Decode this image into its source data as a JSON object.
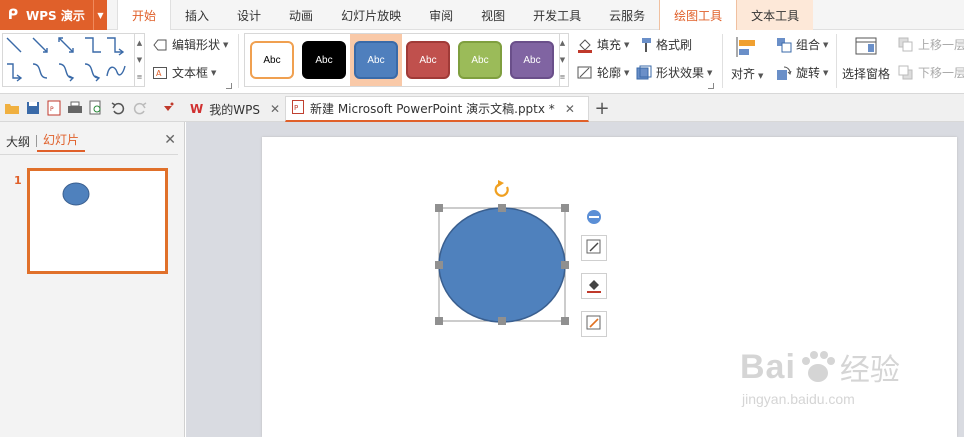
{
  "app": {
    "name": "WPS 演示"
  },
  "menu": {
    "tabs": [
      {
        "label": "开始"
      },
      {
        "label": "插入"
      },
      {
        "label": "设计"
      },
      {
        "label": "动画"
      },
      {
        "label": "幻灯片放映"
      },
      {
        "label": "审阅"
      },
      {
        "label": "视图"
      },
      {
        "label": "开发工具"
      },
      {
        "label": "云服务"
      },
      {
        "label": "绘图工具"
      },
      {
        "label": "文本工具"
      }
    ]
  },
  "ribbon": {
    "edit_shape": "编辑形状",
    "text_box": "文本框",
    "style_sample": "Abc",
    "fill": "填充",
    "format_painter": "格式刷",
    "outline": "轮廓",
    "shape_effects": "形状效果",
    "align": "对齐",
    "group": "组合",
    "rotate": "旋转",
    "selection_pane": "选择窗格",
    "bring_forward": "上移一层",
    "send_backward": "下移一层",
    "style_colors": [
      "#ffffff",
      "#000000",
      "#4f7fbd",
      "#c0504d",
      "#9bbb59",
      "#8064a2"
    ],
    "style_borders": [
      "#f0a050",
      "#000000",
      "#3a6aa8",
      "#a03a37",
      "#7f9f3f",
      "#6a4f8a"
    ]
  },
  "doc_tabs": [
    {
      "label": "我的WPS"
    },
    {
      "label": "新建 Microsoft PowerPoint 演示文稿.pptx *"
    }
  ],
  "left_panel": {
    "tab_outline": "大纲",
    "tab_slides": "幻灯片",
    "slide_number": "1"
  },
  "canvas": {
    "shape_fill": "#4f81bd",
    "shape_stroke": "#3a5f8f",
    "handle_color": "#909090",
    "rotate_color": "#f0a020"
  },
  "watermark": {
    "brand": "Bai",
    "brand_cn": "经验",
    "url": "jingyan.baidu.com"
  }
}
